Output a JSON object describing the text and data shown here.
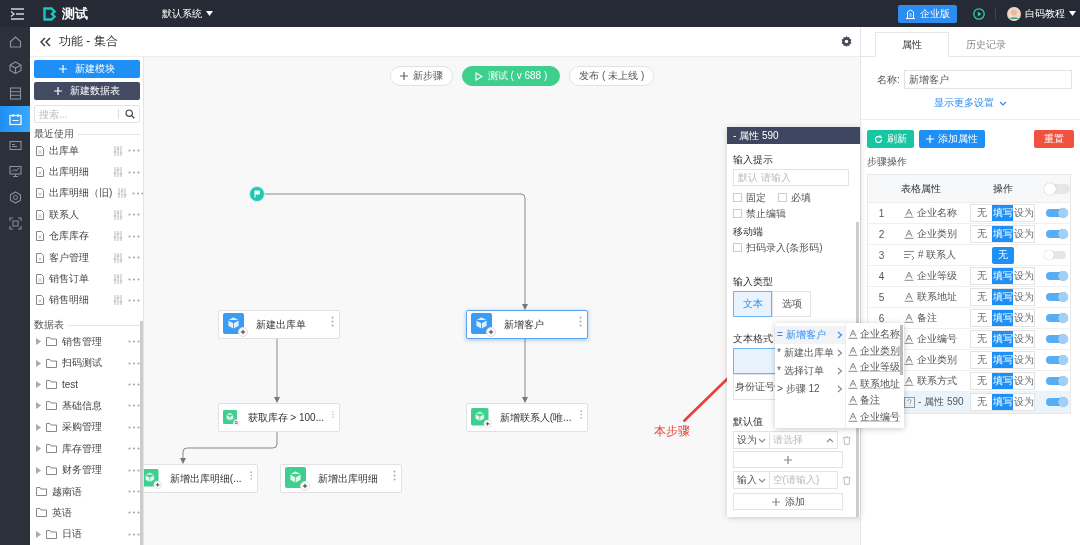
{
  "topbar": {
    "app_name": "测试",
    "system_menu": "默认系统",
    "edition_button": "企业版",
    "user_name": "白码教程"
  },
  "rail": [
    {
      "selected": false
    },
    {
      "selected": false
    },
    {
      "selected": false
    },
    {
      "selected": true
    },
    {
      "selected": false
    },
    {
      "selected": false
    },
    {
      "selected": false
    },
    {
      "selected": false
    }
  ],
  "header": {
    "title": "功能 - 集合"
  },
  "sidebar": {
    "buttons": [
      {
        "label": "新建模块",
        "kind": "primary"
      },
      {
        "label": "新建数据表",
        "kind": "secondary"
      }
    ],
    "search": {
      "placeholder": "搜索..."
    },
    "recent": {
      "title": "最近使用",
      "items": [
        "出库单",
        "出库明细",
        "出库明细（旧)",
        "联系人",
        "仓库库存",
        "客户管理",
        "销售订单",
        "销售明细"
      ]
    },
    "tables": {
      "title": "数据表",
      "items": [
        {
          "label": "销售管理",
          "kind": "group"
        },
        {
          "label": "扫码测试",
          "kind": "group"
        },
        {
          "label": "test",
          "kind": "group"
        },
        {
          "label": "基础信息",
          "kind": "group"
        },
        {
          "label": "采购管理",
          "kind": "group"
        },
        {
          "label": "库存管理",
          "kind": "group"
        },
        {
          "label": "财务管理",
          "kind": "group"
        },
        {
          "label": "越南语",
          "kind": "plain"
        },
        {
          "label": "英语",
          "kind": "plain"
        },
        {
          "label": "日语",
          "kind": "group"
        }
      ]
    }
  },
  "toolbar": {
    "new_step": "新步骤",
    "test": "测试 ( v 688 )",
    "publish": "发布 ( 未上线 )"
  },
  "flow": {
    "nodes": [
      {
        "label": "新建出库单",
        "kind": "create",
        "selected": false
      },
      {
        "label": "新增客户",
        "kind": "create",
        "selected": true
      },
      {
        "label": "获取库存 > 100...",
        "kind": "query",
        "selected": false
      },
      {
        "label": "新增联系人(唯...",
        "kind": "insert",
        "selected": false
      },
      {
        "label": "新增出库明细(...",
        "kind": "insert",
        "selected": false
      },
      {
        "label": "新增出库明细",
        "kind": "insert",
        "selected": false
      }
    ]
  },
  "annotation": {
    "text": "本步骤"
  },
  "property_panel": {
    "title": "- 属性 590",
    "input_hint": {
      "label": "输入提示",
      "placeholder": "默认 请输入"
    },
    "options": [
      {
        "label": "固定",
        "checked": false
      },
      {
        "label": "必填",
        "checked": false
      },
      {
        "label": "禁止编辑",
        "checked": false
      }
    ],
    "mobile": {
      "label": "移动端",
      "options": [
        {
          "label": "扫码录入(条形码)",
          "checked": false
        }
      ]
    },
    "input_type": {
      "label": "输入类型",
      "options": [
        {
          "label": "文本",
          "selected": true
        },
        {
          "label": "选项",
          "selected": false
        }
      ]
    },
    "text_format": {
      "label": "文本格式",
      "options": [
        {
          "selected": true
        },
        {
          "label": "身份证号",
          "selected": false
        }
      ]
    },
    "default_value": {
      "label": "默认值",
      "rows": [
        {
          "mode": "设为",
          "placeholder": "请选择",
          "kind": "select"
        },
        {
          "mode": "输入",
          "placeholder": "空(请输入)",
          "kind": "input"
        }
      ],
      "add_button": "添加"
    }
  },
  "dropdown": {
    "steps": [
      {
        "label": "= 新增客户",
        "selected": true
      },
      {
        "label": "* 新建出库单",
        "selected": false
      },
      {
        "label": "* 选择订单",
        "selected": false
      },
      {
        "label": "> 步骤 12",
        "selected": false
      }
    ],
    "fields": [
      "企业名称",
      "企业类别",
      "企业等级",
      "联系地址",
      "备注",
      "企业编号"
    ]
  },
  "right_panel": {
    "tabs": [
      {
        "label": "属性",
        "selected": true
      },
      {
        "label": "历史记录",
        "selected": false
      }
    ],
    "name": {
      "label": "名称:",
      "value": "新增客户"
    },
    "more_settings": "显示更多设置",
    "buttons": [
      {
        "label": "刷新",
        "kind": "refresh"
      },
      {
        "label": "添加属性",
        "kind": "add"
      },
      {
        "label": "重置",
        "kind": "reset"
      }
    ],
    "section_title": "步骤操作",
    "table": {
      "columns": [
        "表格属性",
        "操作"
      ],
      "header_toggle": {
        "on": false
      },
      "rows": [
        {
          "index": "1",
          "kind": "text",
          "name": "企业名称",
          "ops": [
            {
              "label": "无",
              "selected": false
            },
            {
              "label": "填写",
              "selected": true
            },
            {
              "label": "设为",
              "selected": false
            }
          ],
          "on": true,
          "selected": false
        },
        {
          "index": "2",
          "kind": "text",
          "name": "企业类别",
          "ops": [
            {
              "label": "无",
              "selected": false
            },
            {
              "label": "填写",
              "selected": true
            },
            {
              "label": "设为",
              "selected": false
            }
          ],
          "on": true,
          "selected": false
        },
        {
          "index": "3",
          "kind": "relation",
          "name": "# 联系人",
          "ops": [
            {
              "label": "无",
              "selected": true
            }
          ],
          "on": false,
          "selected": false
        },
        {
          "index": "4",
          "kind": "text",
          "name": "企业等级",
          "ops": [
            {
              "label": "无",
              "selected": false
            },
            {
              "label": "填写",
              "selected": true
            },
            {
              "label": "设为",
              "selected": false
            }
          ],
          "on": true,
          "selected": false
        },
        {
          "index": "5",
          "kind": "text",
          "name": "联系地址",
          "ops": [
            {
              "label": "无",
              "selected": false
            },
            {
              "label": "填写",
              "selected": true
            },
            {
              "label": "设为",
              "selected": false
            }
          ],
          "on": true,
          "selected": false
        },
        {
          "index": "6",
          "kind": "text",
          "name": "备注",
          "ops": [
            {
              "label": "无",
              "selected": false
            },
            {
              "label": "填写",
              "selected": true
            },
            {
              "label": "设为",
              "selected": false
            }
          ],
          "on": true,
          "selected": false
        },
        {
          "kind": "text",
          "name": "企业编号",
          "ops": [
            {
              "label": "无",
              "selected": false
            },
            {
              "label": "填写",
              "selected": true
            },
            {
              "label": "设为",
              "selected": false
            }
          ],
          "on": true,
          "selected": false
        },
        {
          "kind": "text",
          "name": "企业类别",
          "ops": [
            {
              "label": "无",
              "selected": false
            },
            {
              "label": "填写",
              "selected": true
            },
            {
              "label": "设为",
              "selected": false
            }
          ],
          "on": true,
          "selected": false
        },
        {
          "kind": "text",
          "name": "联系方式",
          "ops": [
            {
              "label": "无",
              "selected": false
            },
            {
              "label": "填写",
              "selected": true
            },
            {
              "label": "设为",
              "selected": false
            }
          ],
          "on": true,
          "selected": false
        },
        {
          "kind": "unknown",
          "name": "- 属性 590",
          "ops": [
            {
              "label": "无",
              "selected": false
            },
            {
              "label": "填写",
              "selected": true
            },
            {
              "label": "设为",
              "selected": false
            }
          ],
          "on": true,
          "selected": true
        }
      ]
    }
  }
}
